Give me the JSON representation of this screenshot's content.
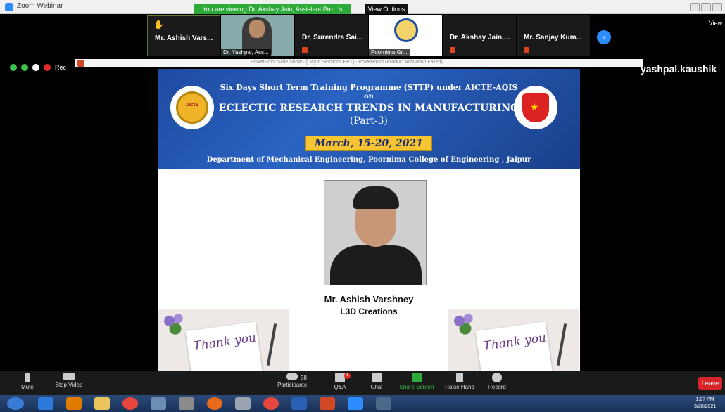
{
  "window": {
    "title": "Zoom Webinar",
    "viewing_banner": "You are viewing Dr. Akshay Jain, Assistant Pro...'s screen",
    "view_options": "View Options ⌄"
  },
  "participants": [
    {
      "name": "Mr. Ashish Vars..."
    },
    {
      "name": "Dr. Yashpal, Ass..."
    },
    {
      "name": "Dr. Surendra Sai..."
    },
    {
      "name": "Poornima Gr..."
    },
    {
      "name": "Dr. Akshay Jain,..."
    },
    {
      "name": "Mr. Sanjay Kum..."
    }
  ],
  "view_toggle_label": "View",
  "recording_label": "Rec",
  "ppt_window_title": "PowerPoint Slide Show - [Day 6 Sessions PPT] - PowerPoint (Product Activation Failed)",
  "shared_username": "yashpal.kaushik",
  "slide": {
    "line1": "Six Days Short Term Training Programme (STTP) under AICTE-AQIS",
    "line2": "on",
    "line3": "ECLECTIC RESEARCH TRENDS IN MANUFACTURING",
    "line4": "(Part-3)",
    "date": "March, 15-20, 2021",
    "line5": "Department of Mechanical Engineering, Poornima College of Engineering , Jaipur",
    "aicte_logo_text": "AICTE",
    "speaker_name": "Mr. Ashish Varshney",
    "speaker_org": "L3D Creations",
    "thank_you": "Thank you"
  },
  "toolbar": {
    "mute": "Mute",
    "stop_video": "Stop Video",
    "participants": "Participants",
    "participant_count": "38",
    "qa": "Q&A",
    "qa_badge": "1",
    "chat": "Chat",
    "share_screen": "Share Screen",
    "raise_hand": "Raise Hand",
    "record": "Record",
    "leave": "Leave"
  },
  "taskbar": {
    "time": "1:27 PM",
    "date": "3/20/2021"
  }
}
